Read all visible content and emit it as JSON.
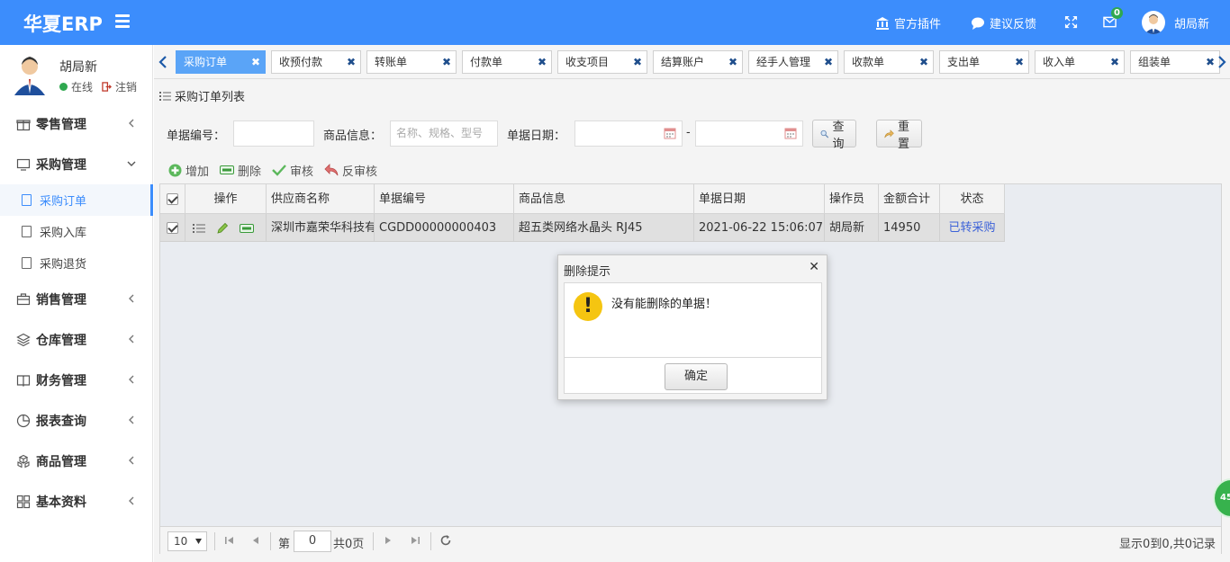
{
  "header": {
    "logo": "华夏ERP",
    "plugins": "官方插件",
    "feedback": "建议反馈",
    "message_count": "0",
    "user_name": "胡局新"
  },
  "sidebar": {
    "user_name": "胡局新",
    "status": "在线",
    "logout": "注销",
    "menu": [
      {
        "label": "零售管理"
      },
      {
        "label": "采购管理"
      },
      {
        "label": "销售管理"
      },
      {
        "label": "仓库管理"
      },
      {
        "label": "财务管理"
      },
      {
        "label": "报表查询"
      },
      {
        "label": "商品管理"
      },
      {
        "label": "基本资料"
      }
    ],
    "submenu": [
      {
        "label": "采购订单"
      },
      {
        "label": "采购入库"
      },
      {
        "label": "采购退货"
      }
    ]
  },
  "tabs": [
    {
      "label": "采购订单"
    },
    {
      "label": "收预付款"
    },
    {
      "label": "转账单"
    },
    {
      "label": "付款单"
    },
    {
      "label": "收支项目"
    },
    {
      "label": "结算账户"
    },
    {
      "label": "经手人管理"
    },
    {
      "label": "收款单"
    },
    {
      "label": "支出单"
    },
    {
      "label": "收入单"
    },
    {
      "label": "组装单"
    }
  ],
  "panel": {
    "title": "采购订单列表",
    "search": {
      "bill_no_label": "单据编号：",
      "goods_label": "商品信息：",
      "goods_placeholder": "名称、规格、型号",
      "date_label": "单据日期：",
      "date_sep": "-",
      "query": "查询",
      "reset": "重置"
    },
    "toolbar": {
      "add": "增加",
      "delete": "删除",
      "audit": "审核",
      "unaudit": "反审核"
    },
    "columns": [
      "操作",
      "供应商名称",
      "单据编号",
      "商品信息",
      "单据日期",
      "操作员",
      "金额合计",
      "状态"
    ],
    "rows": [
      {
        "supplier": "深圳市嘉荣华科技有限公司",
        "bill_no": "CGDD00000000403",
        "goods": "超五类网络水晶头 RJ45",
        "date": "2021-06-22 15:06:07",
        "operator": "胡局新",
        "amount": "14950",
        "status": "已转采购"
      }
    ],
    "pager": {
      "page_size": "10",
      "page_prefix": "第",
      "page_value": "0",
      "page_suffix": "共0页",
      "summary": "显示0到0,共0记录"
    }
  },
  "dialog": {
    "title": "删除提示",
    "message": "没有能删除的单据！",
    "ok": "确定"
  },
  "float_badge": "45",
  "colors": {
    "primary": "#3c8dfc",
    "status_link": "#3c62d8",
    "warning": "#f5c511",
    "online": "#2fa84f"
  }
}
